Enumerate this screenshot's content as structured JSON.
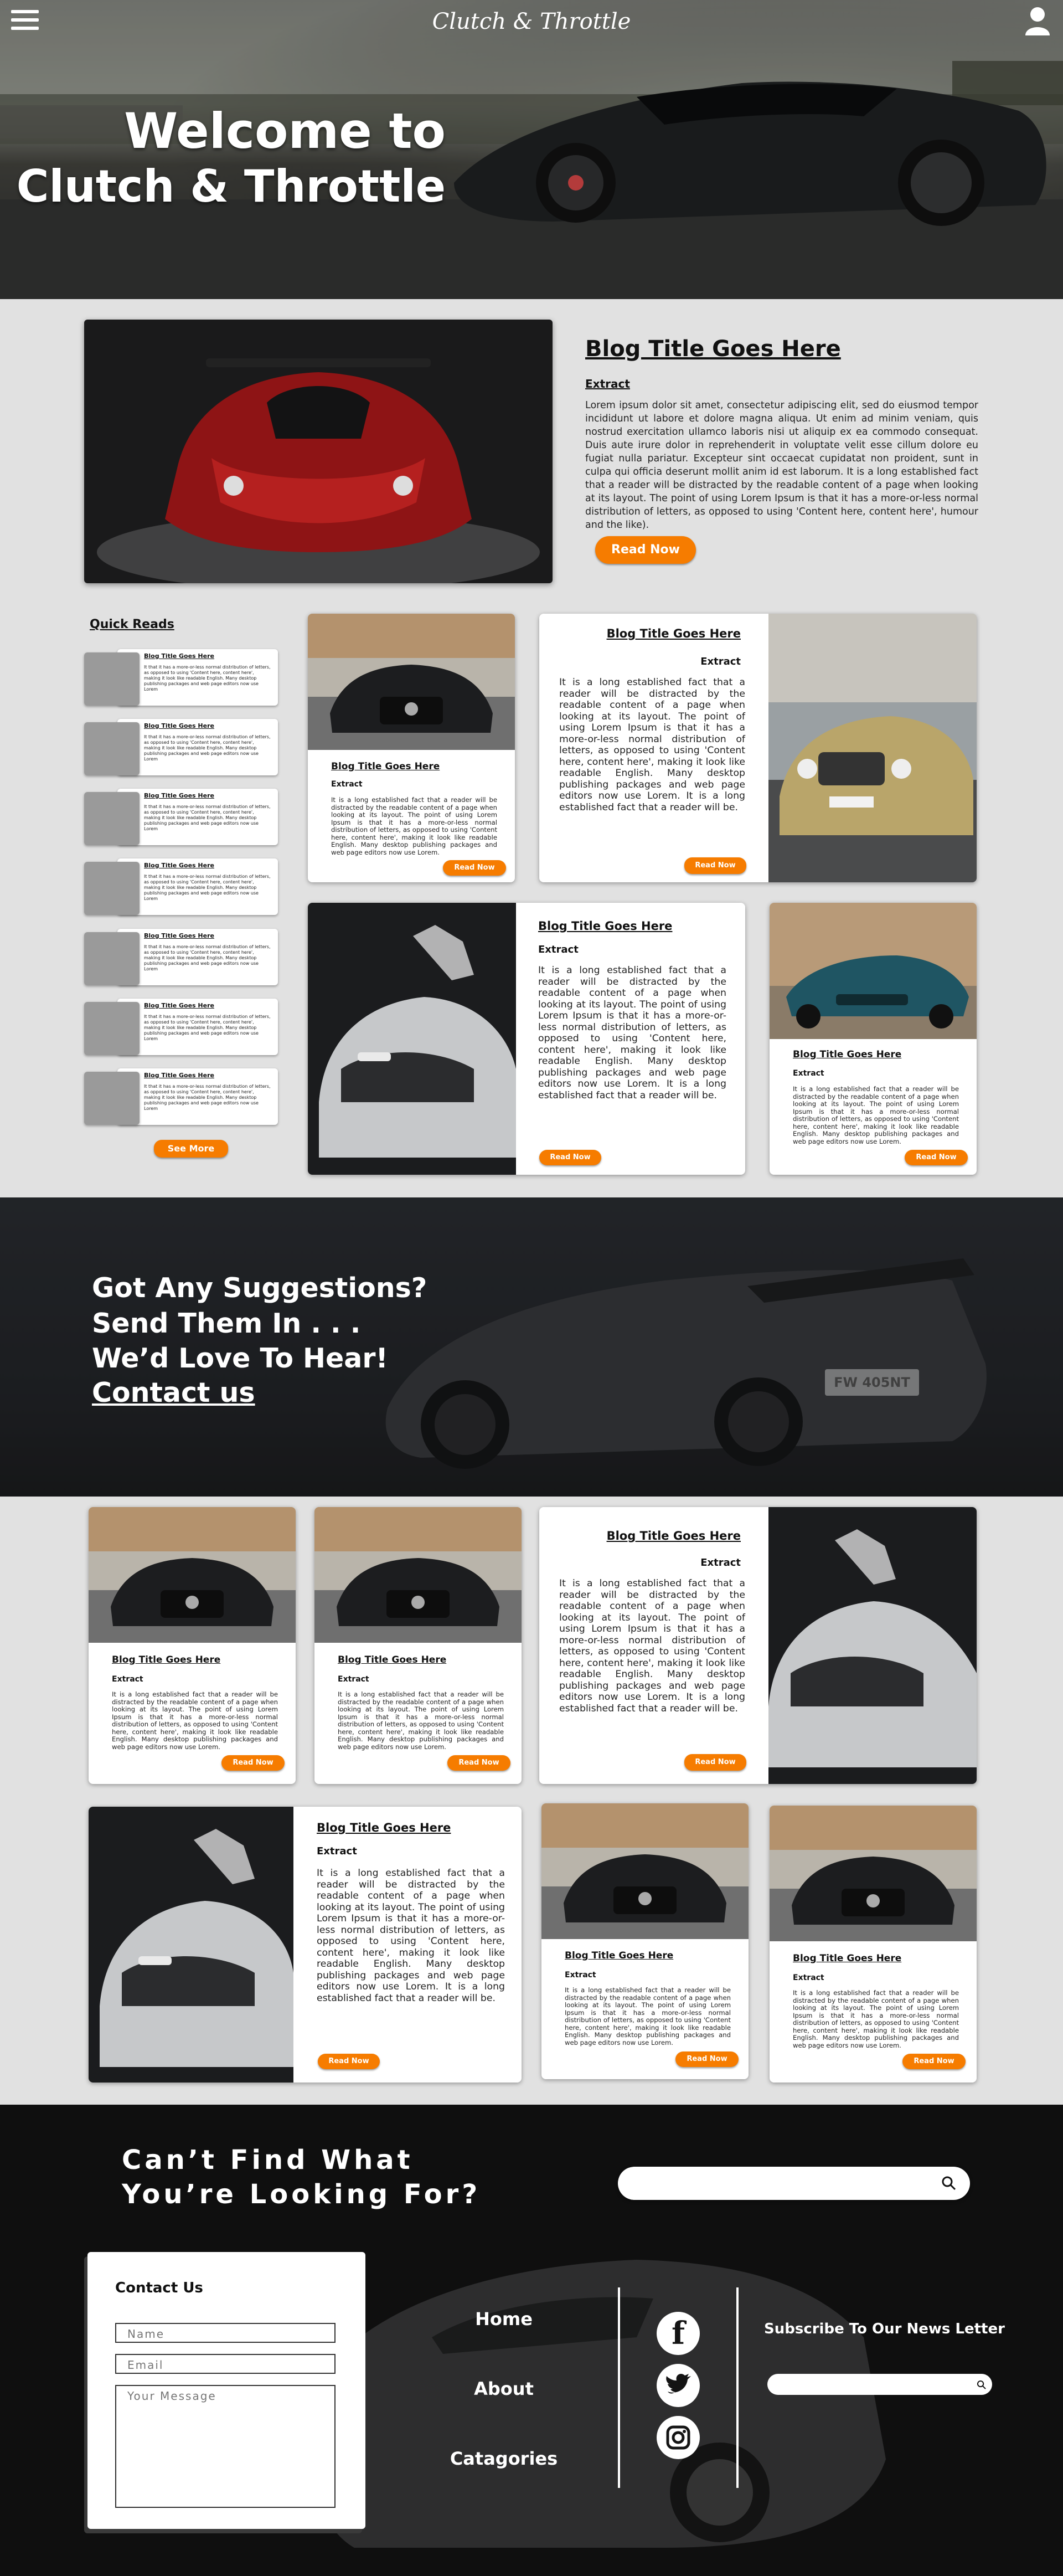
{
  "header": {
    "logo": "Clutch & Throttle"
  },
  "hero": {
    "line1": "Welcome to",
    "line2": "Clutch & Throttle"
  },
  "featured": {
    "title": "Blog Title Goes Here",
    "extract_label": "Extract",
    "body": "Lorem ipsum dolor sit amet, consectetur adipiscing elit, sed do eiusmod tempor incididunt ut labore et dolore magna aliqua. Ut enim ad minim veniam, quis nostrud exercitation ullamco laboris nisi ut aliquip ex ea commodo consequat. Duis aute irure dolor in reprehenderit in voluptate velit esse cillum dolore eu fugiat nulla pariatur. Excepteur sint occaecat cupidatat non proident, sunt in culpa qui officia deserunt mollit anim id est laborum.  It is a long established fact that a reader will be distracted by the readable content of a page when looking at its layout. The point of using Lorem Ipsum is that it has a more-or-less normal distribution of letters, as opposed to using 'Content here, content here', humour and the like).",
    "button": "Read Now"
  },
  "quick": {
    "heading": "Quick Reads",
    "item_title": "Blog Title Goes Here",
    "item_text": "It that it has a more-or-less normal distribution of letters, as opposed to using 'Content here, content here', making it look like readable English. Many desktop publishing packages and web page editors now use Lorem",
    "see_more": "See More"
  },
  "card": {
    "title": "Blog Title Goes Here",
    "extract": "Extract",
    "body": "It is a long established fact that a reader will be distracted by the readable content of a page when looking at its layout. The point of using Lorem Ipsum is that it has a more-or-less normal distribution of letters, as opposed to using 'Content here, content here', making it look like readable English. Many desktop publishing packages and web page editors now use Lorem. It is a long established fact that a reader will be.",
    "body_short": "It is a long established fact that a reader will be distracted by the readable content of a page when looking at its layout. The point of using Lorem Ipsum is that it has a more-or-less normal distribution of letters, as opposed to using 'Content here, content here', making it look like readable English. Many desktop publishing packages and web page editors now use Lorem.",
    "button": "Read Now"
  },
  "suggest": {
    "line1": "Got Any Suggestions?",
    "line2": "Send Them In . . .",
    "line3": "We’d Love To Hear!",
    "link": "Contact us",
    "plate": "FW 405NT"
  },
  "footer": {
    "search_heading_1": "Can’t Find What",
    "search_heading_2": "You’re Looking For?",
    "contact_title": "Contact Us",
    "name_ph": "Name",
    "email_ph": "Email",
    "message_ph": "Your Message",
    "nav": [
      "Home",
      "About",
      "Catagories"
    ],
    "newsletter": "Subscribe To Our News Letter"
  },
  "colors": {
    "accent": "#f67c00",
    "dark": "#1c1c1c",
    "light": "#e1e1e1"
  }
}
